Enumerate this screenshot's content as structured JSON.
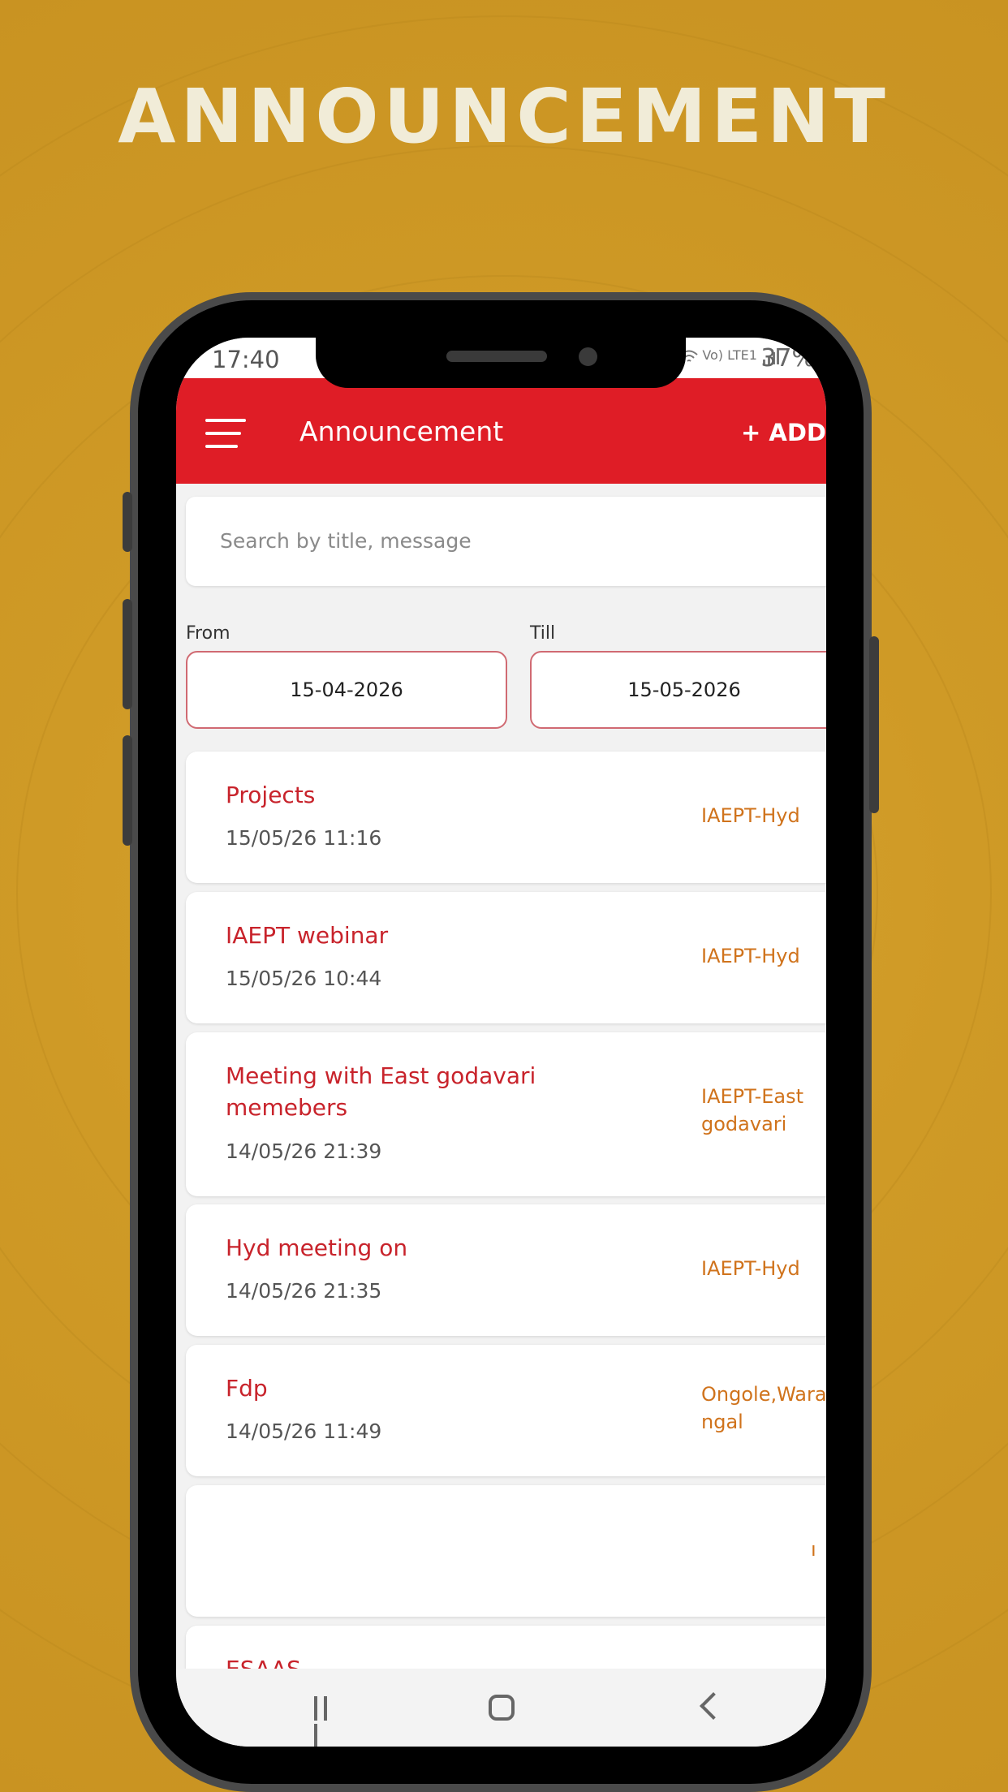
{
  "headline": "ANNOUNCEMENT",
  "status_bar": {
    "time": "17:40",
    "signal_text": "Vo) LTE1",
    "battery": "37%"
  },
  "app_bar": {
    "title": "Announcement",
    "add_label": "+ ADD"
  },
  "search": {
    "placeholder": "Search by title, message"
  },
  "filters": {
    "from_label": "From",
    "from_value": "15-04-2026",
    "till_label": "Till",
    "till_value": "15-05-2026"
  },
  "announcements": [
    {
      "title": "Projects",
      "date": "15/05/26 11:16",
      "location": "IAEPT-Hyd"
    },
    {
      "title": "IAEPT webinar",
      "date": "15/05/26 10:44",
      "location": "IAEPT-Hyd"
    },
    {
      "title": "Meeting with East godavari memebers",
      "date": "14/05/26 21:39",
      "location": "IAEPT-East godavari"
    },
    {
      "title": "Hyd meeting on",
      "date": "14/05/26 21:35",
      "location": "IAEPT-Hyd"
    },
    {
      "title": "Fdp",
      "date": "14/05/26 11:49",
      "location": "Ongole,Warangal"
    },
    {
      "title": "",
      "date": "",
      "location": "ı"
    },
    {
      "title": "ESAAS",
      "date": "",
      "location": ""
    }
  ],
  "colors": {
    "background": "#cf9a26",
    "app_bar": "#df1d26",
    "title_text": "#c8232b",
    "location_text": "#d0731c"
  },
  "icons": [
    "menu-icon",
    "wifi-icon",
    "signal-icon",
    "recent-apps-icon",
    "home-icon",
    "back-icon"
  ]
}
